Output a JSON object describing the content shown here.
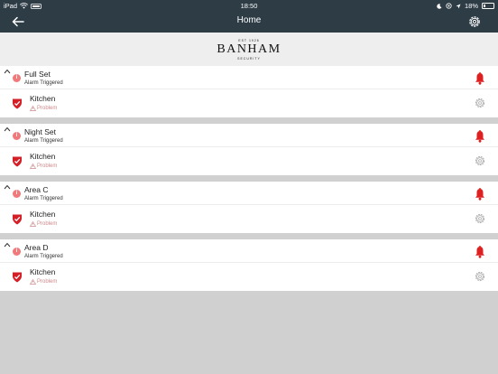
{
  "status_bar": {
    "device": "iPad",
    "time": "18:50",
    "battery": "18%"
  },
  "nav": {
    "title": "Home",
    "back_icon": "arrow-left-icon",
    "settings_icon": "gear-icon"
  },
  "logo": {
    "est": "EST 1926",
    "name": "BANHAM",
    "sub": "SECURITY"
  },
  "areas": [
    {
      "name": "Full Set",
      "status": "Alarm Triggered",
      "device": {
        "name": "Kitchen",
        "status": "Problem"
      }
    },
    {
      "name": "Night Set",
      "status": "Alarm Triggered",
      "device": {
        "name": "Kitchen",
        "status": "Problem"
      }
    },
    {
      "name": "Area C",
      "status": "Alarm Triggered",
      "device": {
        "name": "Kitchen",
        "status": "Problem"
      }
    },
    {
      "name": "Area D",
      "status": "Alarm Triggered",
      "device": {
        "name": "Kitchen",
        "status": "Problem"
      }
    }
  ],
  "colors": {
    "nav_bg": "#2e3c46",
    "alert_red": "#e02020",
    "shield_red": "#d41f26",
    "problem_text": "#d08a8a"
  }
}
